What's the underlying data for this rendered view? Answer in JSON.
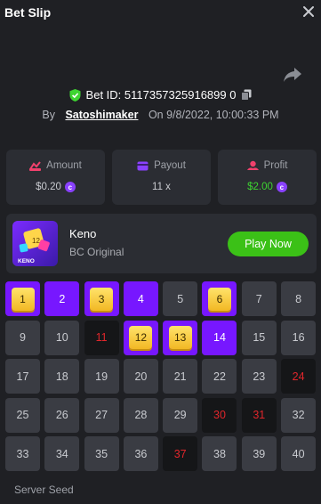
{
  "header": {
    "title": "Bet Slip"
  },
  "bet": {
    "id_label": "Bet ID: 5117357325916899 0",
    "by_label": "By",
    "username": "Satoshimaker",
    "on_label": "On",
    "datetime": "9/8/2022, 10:00:33 PM"
  },
  "stats": {
    "amount": {
      "label": "Amount",
      "value": "$0.20"
    },
    "payout": {
      "label": "Payout",
      "value": "11 x"
    },
    "profit": {
      "label": "Profit",
      "value": "$2.00"
    }
  },
  "game": {
    "thumb_label": "KENO",
    "name": "Keno",
    "subtitle": "BC Original",
    "play_label": "Play Now"
  },
  "grid": {
    "numbers": [
      "1",
      "2",
      "3",
      "4",
      "5",
      "6",
      "7",
      "8",
      "9",
      "10",
      "11",
      "12",
      "13",
      "14",
      "15",
      "16",
      "17",
      "18",
      "19",
      "20",
      "21",
      "22",
      "23",
      "24",
      "25",
      "26",
      "27",
      "28",
      "29",
      "30",
      "31",
      "32",
      "33",
      "34",
      "35",
      "36",
      "37",
      "38",
      "39",
      "40"
    ],
    "hits": [
      1,
      3,
      6,
      12,
      13
    ],
    "picked_no_hit": [
      2,
      4,
      14
    ],
    "drawn_miss": [
      11,
      24,
      30,
      31,
      37
    ]
  },
  "footer": {
    "server_seed_label": "Server Seed"
  },
  "colors": {
    "accent": "#7717ff",
    "play": "#3bc117",
    "profit": "#3ed431",
    "miss": "#e0262b"
  }
}
